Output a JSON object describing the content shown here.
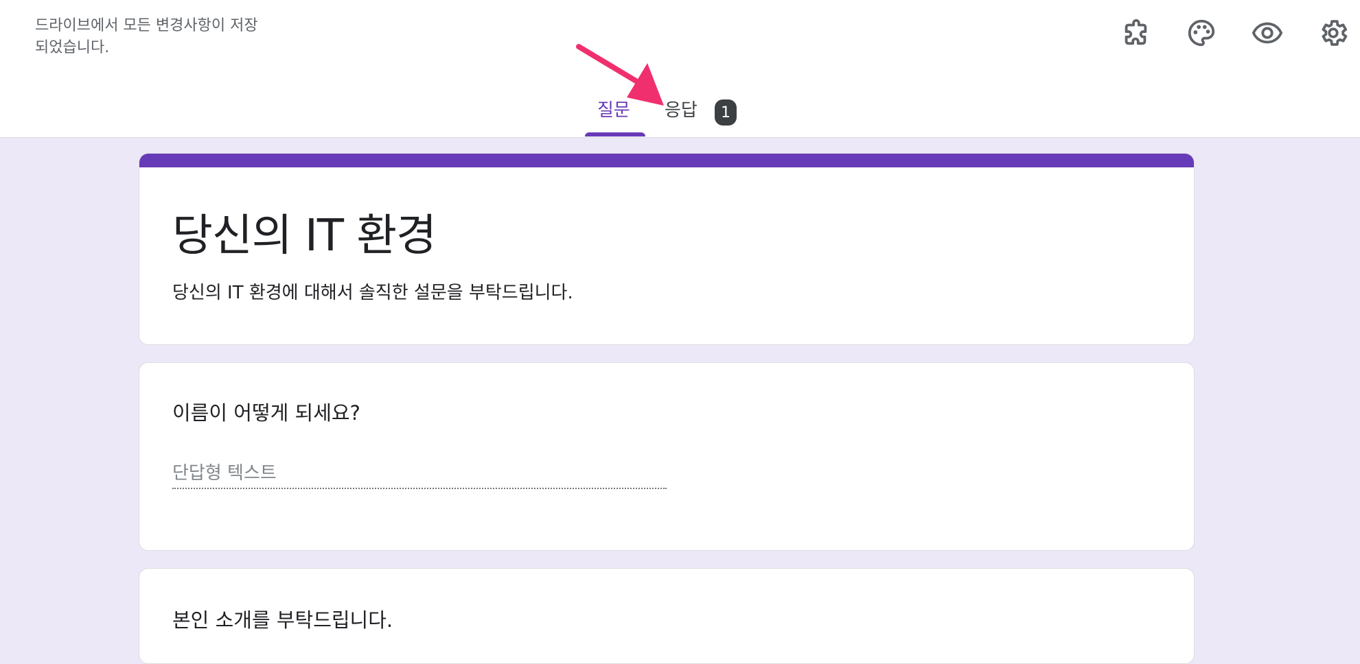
{
  "header": {
    "save_status": "드라이브에서 모든 변경사항이 저장되었습니다.",
    "icons": [
      "add-on-puzzle-icon",
      "palette-icon",
      "preview-eye-icon",
      "settings-gear-icon"
    ]
  },
  "tabs": {
    "questions_label": "질문",
    "responses_label": "응답",
    "responses_count": "1",
    "active": "질문"
  },
  "form": {
    "title": "당신의 IT 환경",
    "description": "당신의 IT 환경에 대해서 솔직한 설문을 부탁드립니다."
  },
  "questions": [
    {
      "title": "이름이 어떻게 되세요?",
      "answer_placeholder": "단답형 텍스트"
    },
    {
      "title": "본인 소개를 부탁드립니다."
    }
  ],
  "colors": {
    "accent": "#673ab7",
    "background": "#ede8f8",
    "annotation_arrow": "#f0306e"
  }
}
